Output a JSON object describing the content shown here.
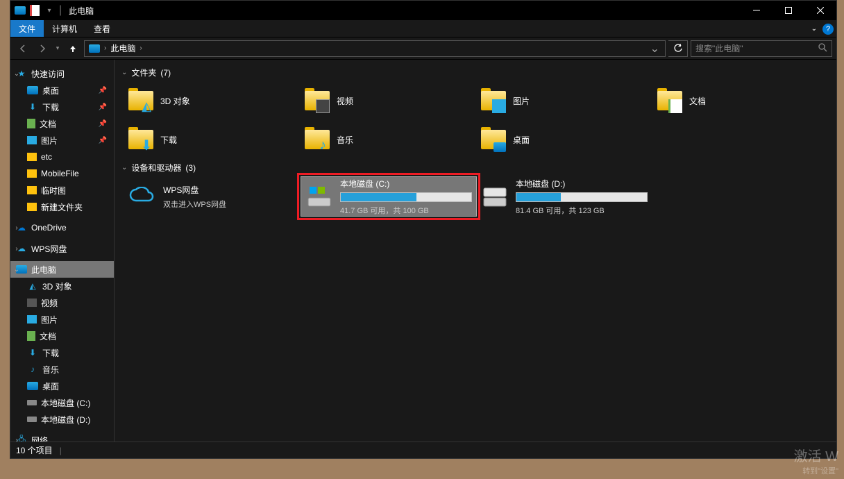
{
  "window": {
    "title": "此电脑"
  },
  "ribbon": {
    "file": "文件",
    "computer": "计算机",
    "view": "查看"
  },
  "address": {
    "location": "此电脑"
  },
  "search": {
    "placeholder": "搜索\"此电脑\""
  },
  "sidebar": {
    "quickAccess": "快速访问",
    "qa": {
      "desktop": "桌面",
      "downloads": "下载",
      "documents": "文档",
      "pictures": "图片",
      "etc": "etc",
      "mobileFile": "MobileFile",
      "tempImg": "临时图",
      "newFolder": "新建文件夹"
    },
    "oneDrive": "OneDrive",
    "wpsCloud": "WPS网盘",
    "thisPC": "此电脑",
    "pc": {
      "objects3d": "3D 对象",
      "videos": "视频",
      "pictures": "图片",
      "documents": "文档",
      "downloads": "下载",
      "music": "音乐",
      "desktop": "桌面",
      "driveC": "本地磁盘 (C:)",
      "driveD": "本地磁盘 (D:)"
    },
    "network": "网络"
  },
  "groups": {
    "folders": {
      "label": "文件夹",
      "count": "(7)"
    },
    "drives": {
      "label": "设备和驱动器",
      "count": "(3)"
    }
  },
  "folders": {
    "objects3d": "3D 对象",
    "videos": "视频",
    "pictures": "图片",
    "documents": "文档",
    "downloads": "下载",
    "music": "音乐",
    "desktop": "桌面"
  },
  "drives": {
    "wps": {
      "name": "WPS网盘",
      "sub": "双击进入WPS网盘"
    },
    "c": {
      "name": "本地磁盘 (C:)",
      "sub": "41.7 GB 可用，共 100 GB",
      "fillPercent": 58
    },
    "d": {
      "name": "本地磁盘 (D:)",
      "sub": "81.4 GB 可用，共 123 GB",
      "fillPercent": 34
    }
  },
  "statusbar": {
    "items": "10 个项目"
  },
  "watermark": {
    "main": "激活 W",
    "sub": "转到\"设置\""
  }
}
